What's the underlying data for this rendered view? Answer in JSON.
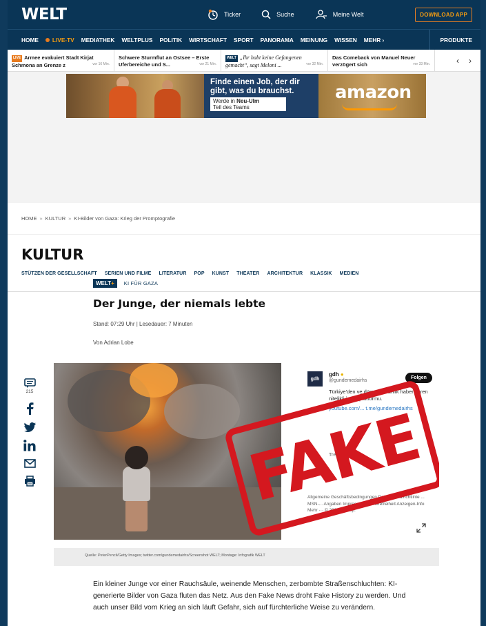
{
  "header": {
    "logo": "WELT",
    "ticker_label": "Ticker",
    "search_label": "Suche",
    "account_label": "Meine Welt",
    "download_label": "DOWNLOAD APP"
  },
  "nav": {
    "items": [
      "HOME",
      "LIVE-TV",
      "MEDIATHEK",
      "WELTPLUS",
      "POLITIK",
      "WIRTSCHAFT",
      "SPORT",
      "PANORAMA",
      "MEINUNG",
      "WISSEN",
      "MEHR ›"
    ],
    "produkte": "PRODUKTE"
  },
  "ticker": {
    "items": [
      {
        "badge": "LIVE",
        "text": "Armee evakuiert Stadt Kirjat Schmona an Grenze z",
        "ago": "vor 16 Min."
      },
      {
        "badge": "",
        "text": "Schwere Sturmflut an Ostsee – Erste Uferbereiche und S...",
        "ago": "vor 21 Min."
      },
      {
        "badge": "WELT",
        "text": "„Ihr habt keine Gefangenen gemacht“, sagt Meloni ...",
        "ago": "vor 32 Min."
      },
      {
        "badge": "",
        "text": "Das Comeback von Manuel Neuer verzögert sich",
        "ago": "vor 33 Min."
      }
    ],
    "prev": "‹",
    "next": "›"
  },
  "ad": {
    "headline": "Finde einen Job, der dir gibt, was du brauchst.",
    "line1_prefix": "Werde in ",
    "line1_bold": "Neu-Ulm",
    "line2": "Teil des Teams",
    "brand": "amazon"
  },
  "breadcrumb": [
    "HOME",
    "KULTUR",
    "KI-Bilder von Gaza: Krieg der Promptografie"
  ],
  "section": {
    "title": "KULTUR",
    "subnav": [
      "STÜTZEN DER GESELLSCHAFT",
      "SERIEN UND FILME",
      "LITERATUR",
      "POP",
      "KUNST",
      "THEATER",
      "ARCHITEKTUR",
      "KLASSIK",
      "MEDIEN"
    ]
  },
  "article": {
    "badge": "WELT",
    "badge_plus": "+",
    "kicker": "KI FÜR GAZA",
    "headline": "Der Junge, der niemals lebte",
    "meta": "Stand: 07:29 Uhr | Lesedauer: 7 Minuten",
    "author": "Von Adrian Lobe",
    "caption": "Quelle: PeterPencil/Getty Images; twitter.com/gundemedairhs/Screenshot WELT; Montage: Infografik WELT",
    "body": "Ein kleiner Junge vor einer Rauchsäule, weinende Menschen, zerbombte Straßenschluchten: KI-generierte Bilder von Gaza fluten das Netz. Aus den Fake News droht Fake History zu werden. Und auch unser Bild vom Krieg an sich läuft Gefahr, sich auf fürchterliche Weise zu verändern."
  },
  "tweet": {
    "avatar": "gdh",
    "name": "gdh",
    "handle": "@gundemedairhs",
    "follow": "Folgen",
    "bio": "Türkiye'den ve dünyadan anlık haber veren nitelikli içerik platformu.",
    "links": "youtube.com/... t.me/gundemedairhs",
    "trend": "Trend...                  ight ver...",
    "footer": "Allgemeine Geschäftsbedingungen Datenschutzrichtlinie ... MSN-... Angaben   Impressum Barrierefreiheit   Anzeigen-Info   Mehr ··· © 2023 X Corp."
  },
  "stamp": "FAKE",
  "share": {
    "comment_count": "215"
  },
  "colors": {
    "brand_navy": "#0a3556",
    "accent_orange": "#e87b1e",
    "stamp_red": "#d4181f"
  }
}
